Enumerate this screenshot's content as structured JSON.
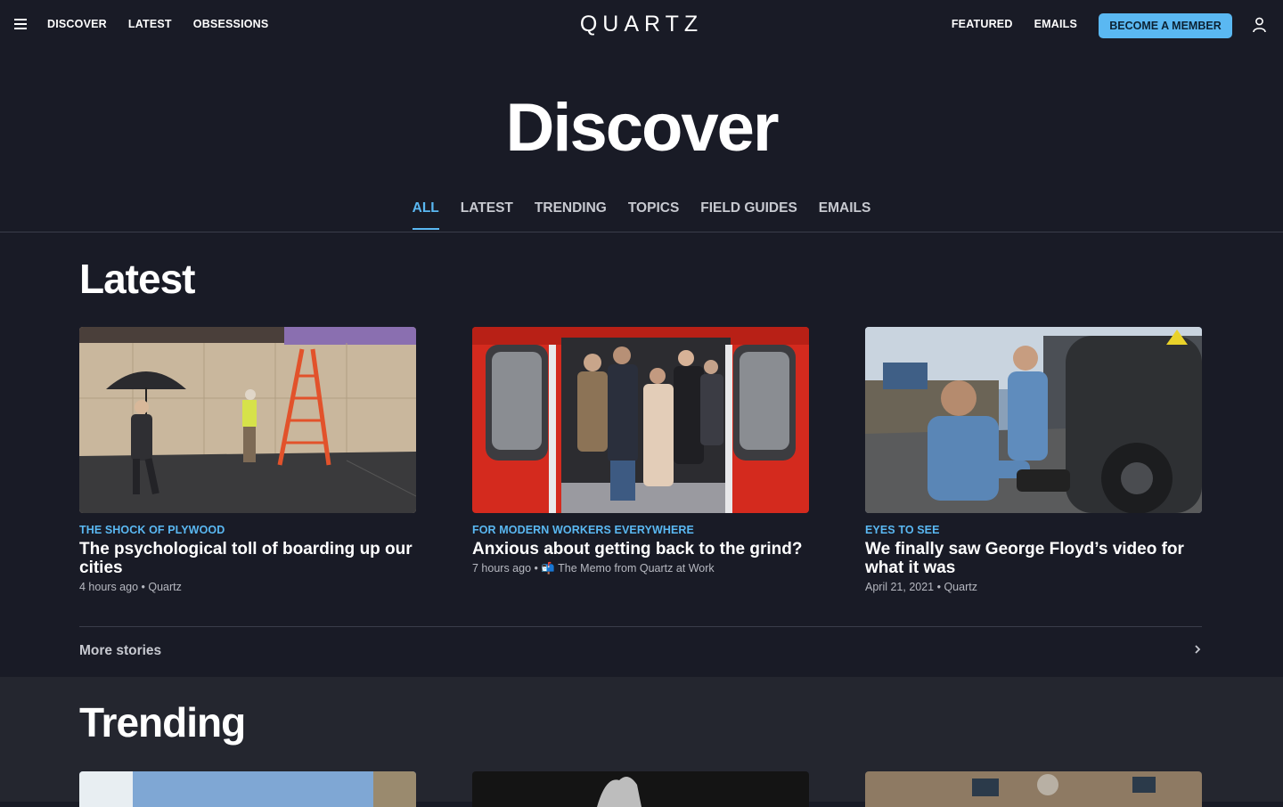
{
  "header": {
    "nav_left": [
      "DISCOVER",
      "LATEST",
      "OBSESSIONS"
    ],
    "logo": "QUARTZ",
    "nav_right": [
      "FEATURED",
      "EMAILS"
    ],
    "member_button": "BECOME A MEMBER"
  },
  "hero": {
    "title": "Discover"
  },
  "tabs": [
    {
      "label": "ALL",
      "active": true
    },
    {
      "label": "LATEST",
      "active": false
    },
    {
      "label": "TRENDING",
      "active": false
    },
    {
      "label": "TOPICS",
      "active": false
    },
    {
      "label": "FIELD GUIDES",
      "active": false
    },
    {
      "label": "EMAILS",
      "active": false
    }
  ],
  "latest": {
    "title": "Latest",
    "cards": [
      {
        "kicker": "THE SHOCK OF PLYWOOD",
        "headline": "The psychological toll of boarding up our cities",
        "meta": "4 hours ago • Quartz",
        "image": "man-with-umbrella-plywood-wall"
      },
      {
        "kicker": "FOR MODERN WORKERS EVERYWHERE",
        "headline": "Anxious about getting back to the grind?",
        "meta": "7 hours ago • 📬 The Memo from Quartz at Work",
        "image": "crowded-subway-train"
      },
      {
        "kicker": "EYES TO SEE",
        "headline": "We finally saw George Floyd’s video for what it was",
        "meta": "April 21, 2021 • Quartz",
        "image": "bodycam-police-officers"
      }
    ],
    "more_label": "More stories"
  },
  "trending": {
    "title": "Trending"
  },
  "colors": {
    "background": "#191b26",
    "trending_background": "#24262f",
    "accent": "#5ab8f2"
  }
}
